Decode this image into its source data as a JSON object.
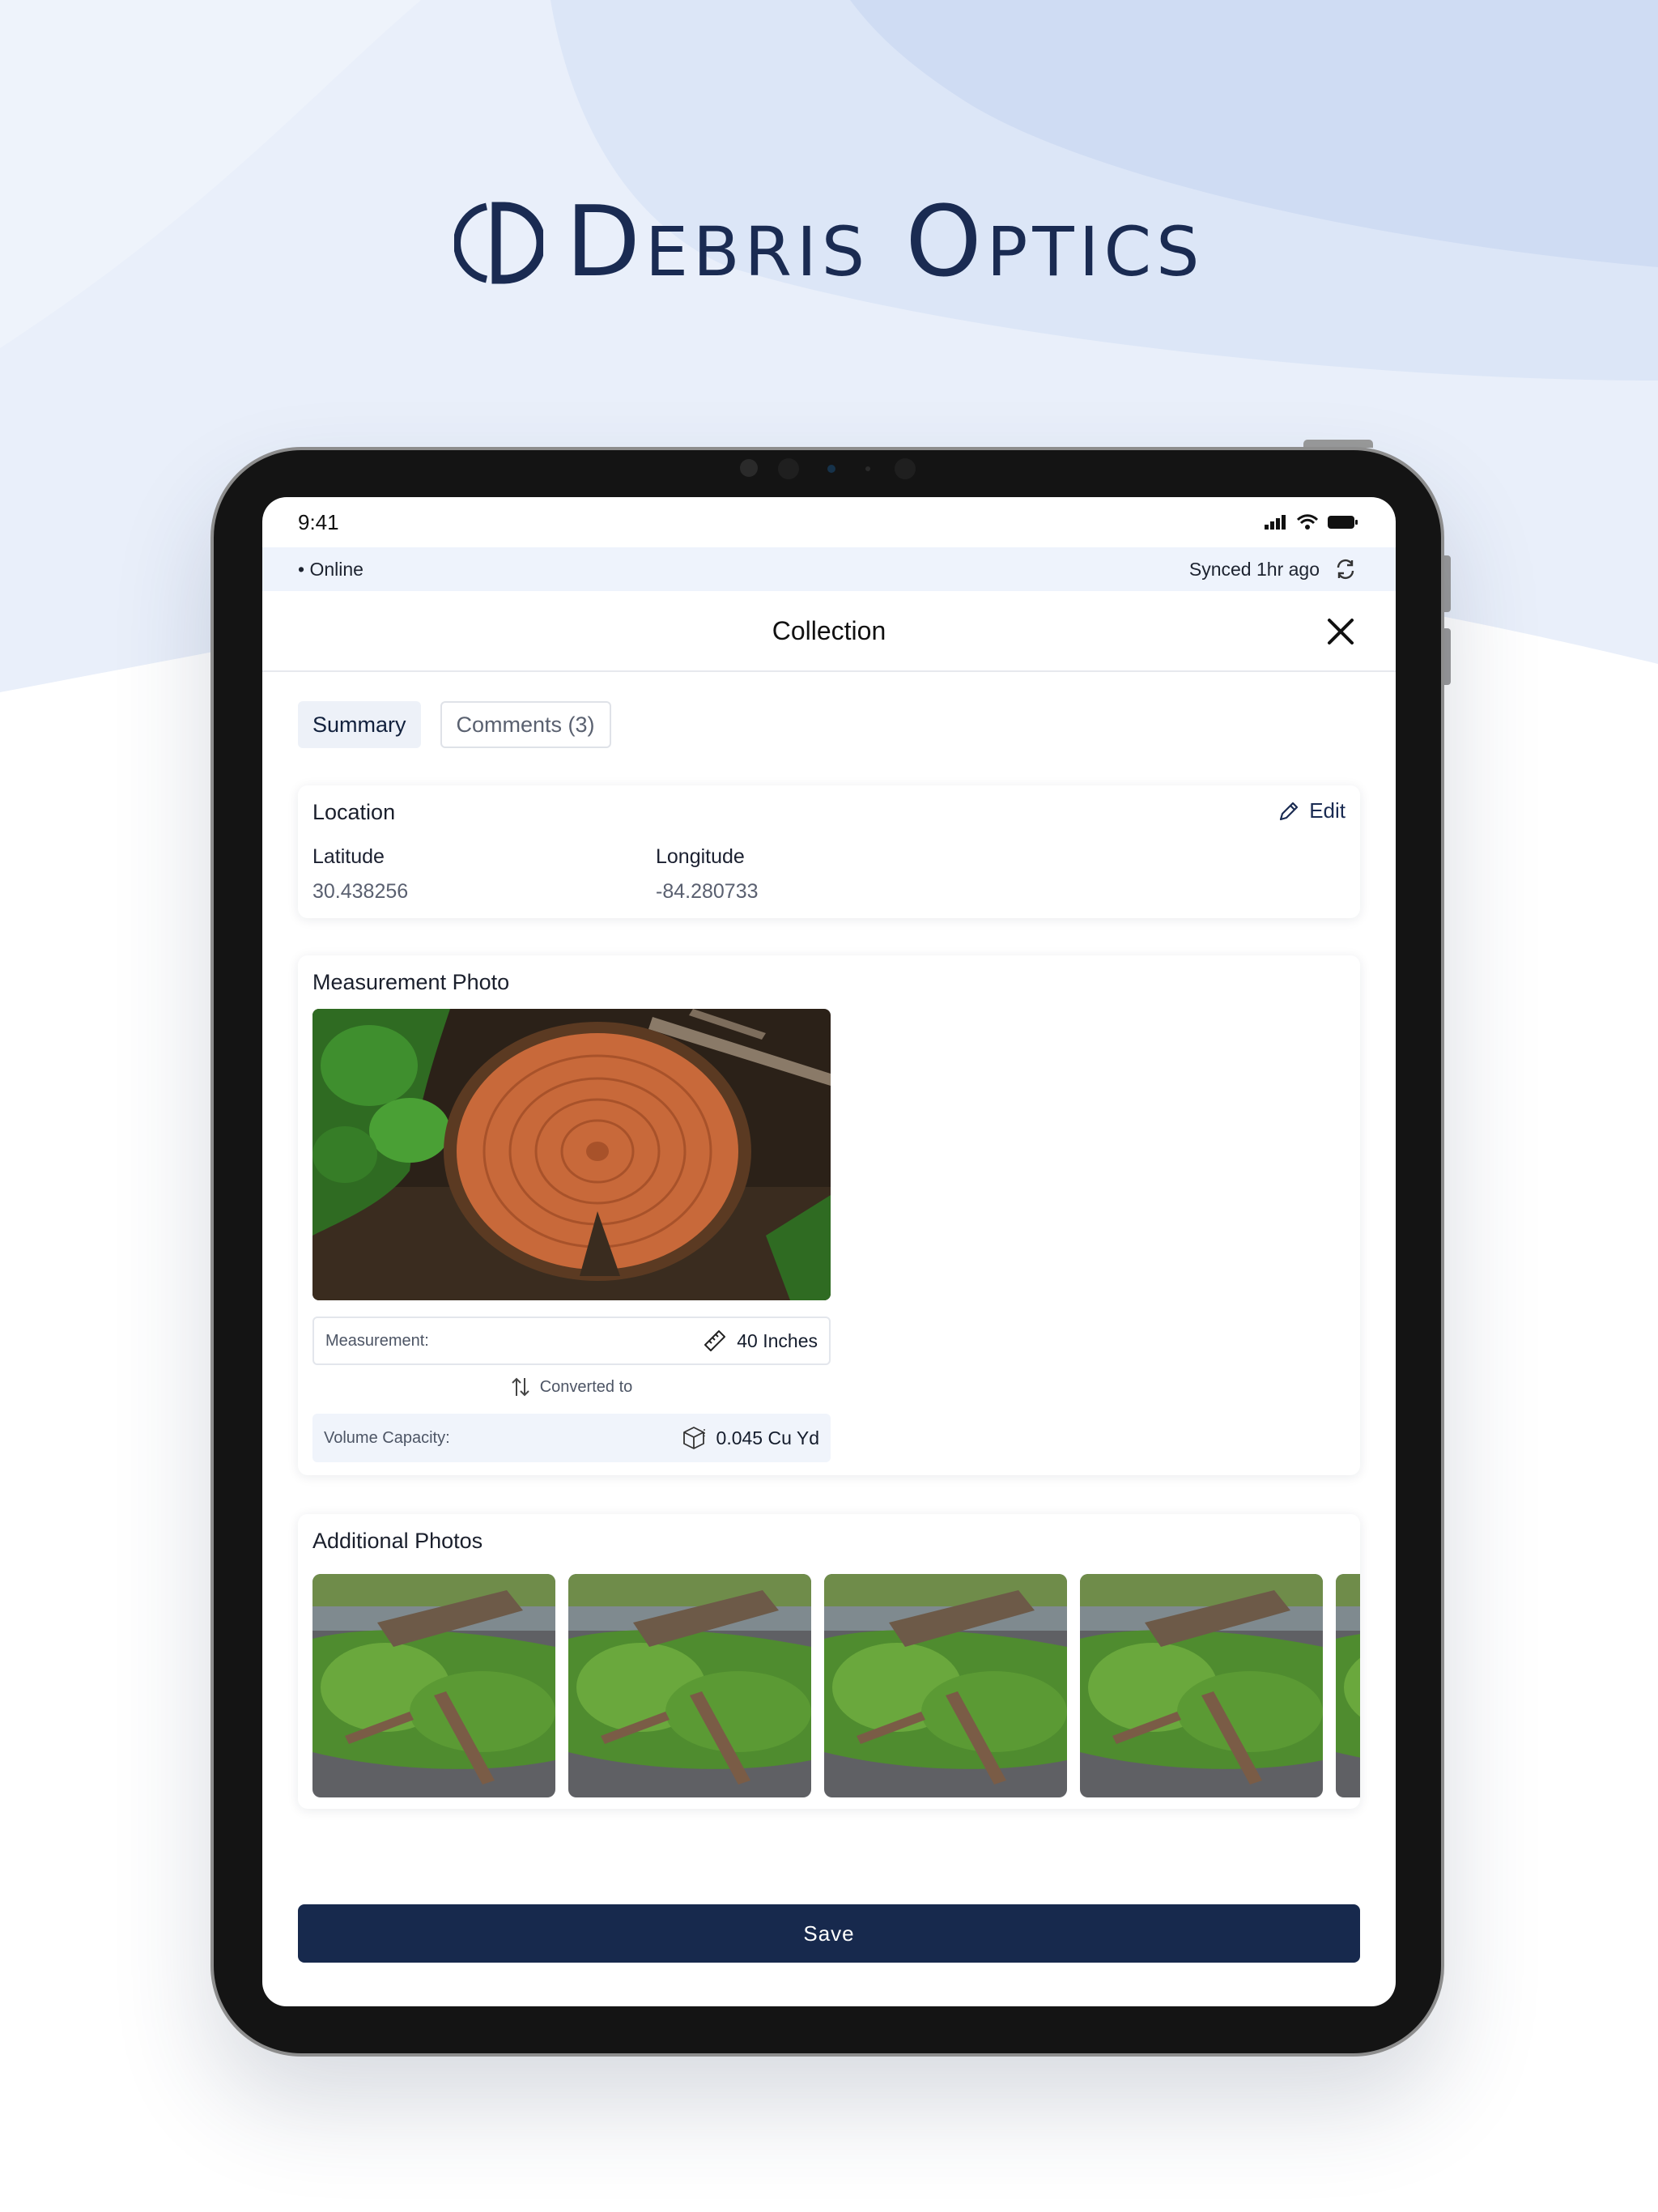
{
  "brand": {
    "name": "Debris Optics"
  },
  "status_bar": {
    "time": "9:41"
  },
  "sync_bar": {
    "connection": "• Online",
    "sync_status": "Synced 1hr ago"
  },
  "header": {
    "title": "Collection"
  },
  "tabs": [
    {
      "label": "Summary",
      "active": true
    },
    {
      "label": "Comments (3)",
      "active": false
    }
  ],
  "location": {
    "title": "Location",
    "edit_label": "Edit",
    "latitude_label": "Latitude",
    "latitude_value": "30.438256",
    "longitude_label": "Longitude",
    "longitude_value": "-84.280733"
  },
  "measurement": {
    "title": "Measurement Photo",
    "measurement_label": "Measurement:",
    "measurement_value": "40 Inches",
    "converted_label": "Converted to",
    "volume_label": "Volume Capacity:",
    "volume_value": "0.045 Cu Yd"
  },
  "additional_photos": {
    "title": "Additional Photos"
  },
  "footer": {
    "save_label": "Save"
  },
  "colors": {
    "brand_navy": "#1a2b52",
    "button_navy": "#17294d",
    "sync_bar_bg": "#eef3fc",
    "tab_active_bg": "#edf1f8"
  }
}
